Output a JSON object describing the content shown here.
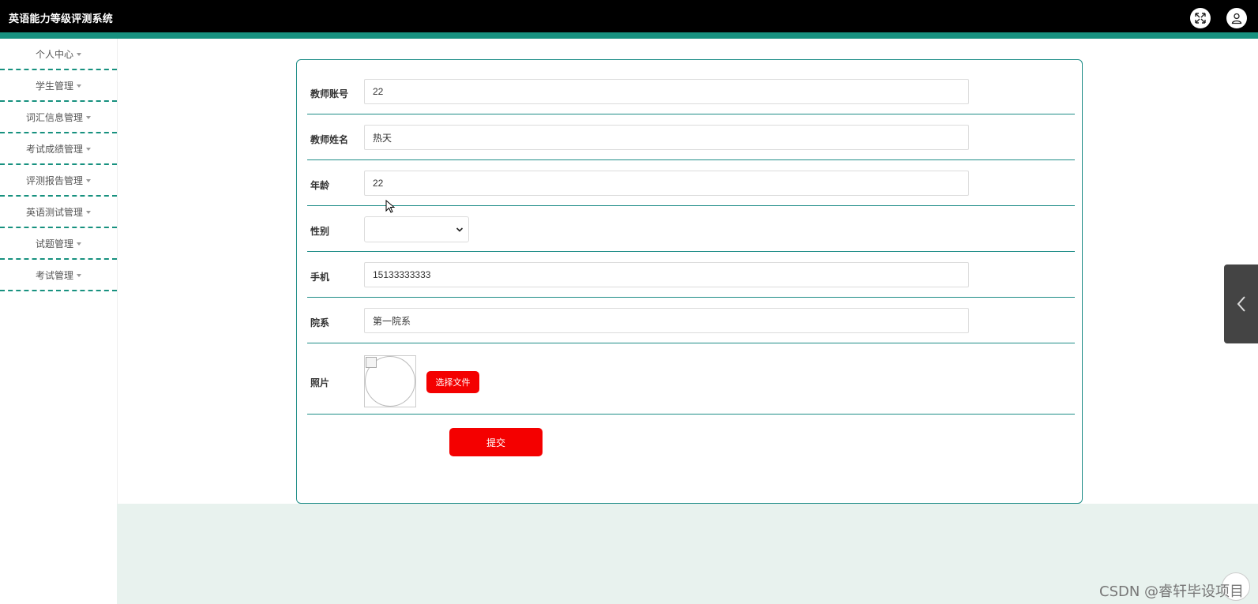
{
  "header": {
    "title": "英语能力等级评测系统",
    "fullscreen_icon": "expand-icon",
    "user_icon": "user-icon",
    "accent_color": "#17917f"
  },
  "sidebar": {
    "items": [
      {
        "label": "个人中心"
      },
      {
        "label": "学生管理"
      },
      {
        "label": "词汇信息管理"
      },
      {
        "label": "考试成绩管理"
      },
      {
        "label": "评测报告管理"
      },
      {
        "label": "英语测试管理"
      },
      {
        "label": "试题管理"
      },
      {
        "label": "考试管理"
      }
    ]
  },
  "form": {
    "teacher_account": {
      "label": "教师账号",
      "value": "22"
    },
    "teacher_name": {
      "label": "教师姓名",
      "value": "热天"
    },
    "age": {
      "label": "年龄",
      "value": "22"
    },
    "gender": {
      "label": "性别",
      "value": ""
    },
    "phone": {
      "label": "手机",
      "value": "15133333333"
    },
    "department": {
      "label": "院系",
      "value": "第一院系"
    },
    "photo": {
      "label": "照片",
      "choose_file_label": "选择文件"
    },
    "submit_label": "提交",
    "button_color": "#f40000",
    "border_color": "#1e8d87"
  },
  "watermark": "CSDN @睿轩毕设项目"
}
